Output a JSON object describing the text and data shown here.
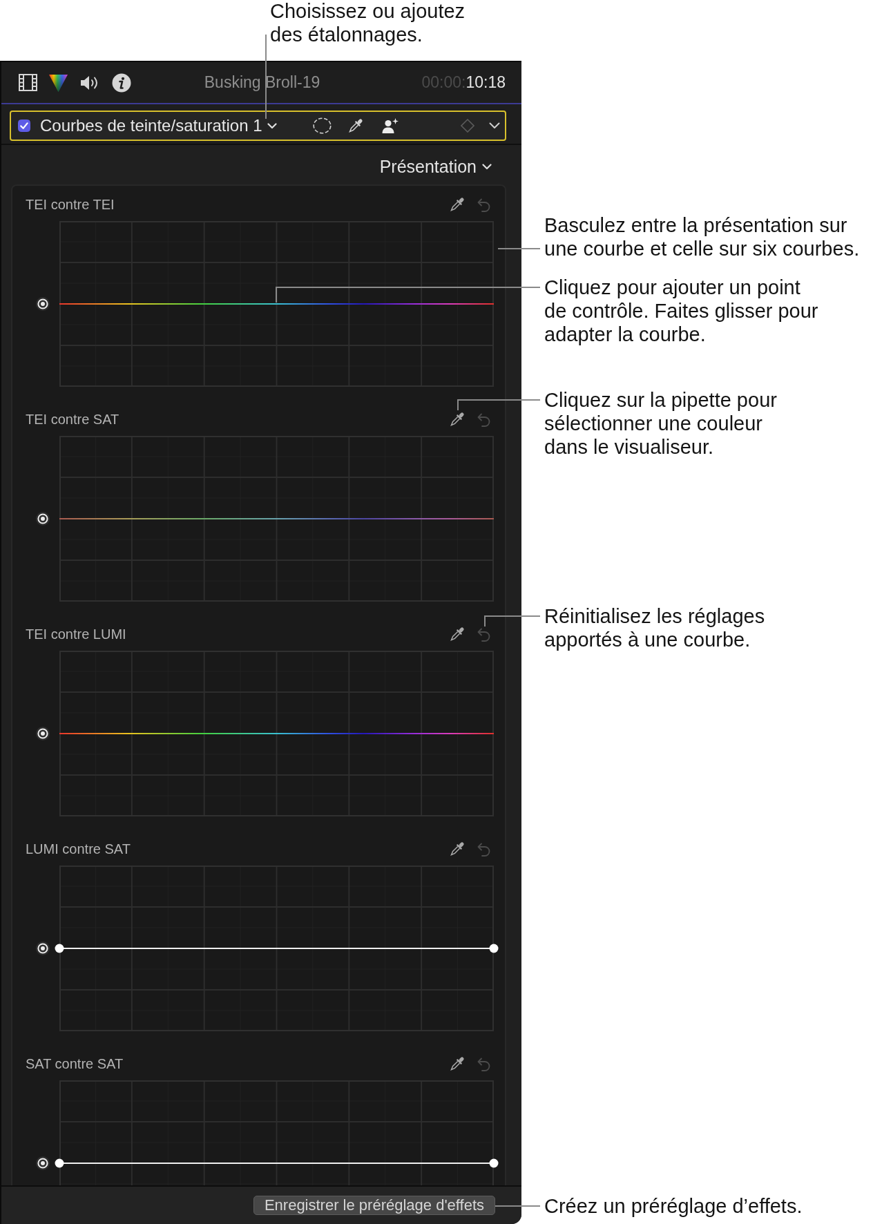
{
  "header": {
    "tabs": [
      {
        "kind": "video",
        "selected": false
      },
      {
        "kind": "color",
        "selected": true
      },
      {
        "kind": "audio",
        "selected": false
      },
      {
        "kind": "info",
        "selected": false
      }
    ],
    "title": "Busking Broll-19",
    "timecode_prefix": "00:00:",
    "timecode": "10:18"
  },
  "effect_bar": {
    "selected": true,
    "checked": true,
    "name": "Courbes de teinte/saturation 1"
  },
  "view_menu": {
    "label": "Présentation"
  },
  "curves": [
    {
      "title": "TEI contre TEI",
      "kind": "hue",
      "reset_disabled": true
    },
    {
      "title": "TEI contre SAT",
      "kind": "hue_muted",
      "reset_disabled": true
    },
    {
      "title": "TEI contre LUMI",
      "kind": "hue",
      "reset_disabled": true
    },
    {
      "title": "LUMI contre SAT",
      "kind": "neutral",
      "reset_disabled": true
    },
    {
      "title": "SAT contre SAT",
      "kind": "neutral",
      "reset_disabled": true
    }
  ],
  "save_button": {
    "label": "Enregistrer le préréglage d'effets"
  },
  "callouts": [
    {
      "text": "Choisissez ou ajoutez\ndes étalonnages."
    },
    {
      "text": "Basculez entre la présentation sur\nune courbe et celle sur six courbes."
    },
    {
      "text": "Cliquez pour ajouter un point\nde contrôle. Faites glisser pour\nadapter la courbe."
    },
    {
      "text": "Cliquez sur la pipette pour\nsélectionner une couleur\ndans le visualiseur."
    },
    {
      "text": "Réinitialisez les réglages\napportés à une courbe."
    },
    {
      "text": "Créez un préréglage d’effets."
    }
  ]
}
